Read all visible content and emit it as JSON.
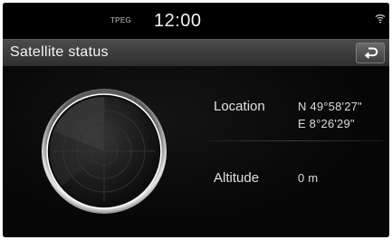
{
  "status_bar": {
    "source_label": "TPEG",
    "clock": "12:00",
    "signal_icon": "wifi-icon"
  },
  "header": {
    "title": "Satellite status",
    "back_icon": "back-arrow-icon"
  },
  "main": {
    "location_label": "Location",
    "latitude": "N 49°58'27\"",
    "longitude": "E 8°26'29\"",
    "altitude_label": "Altitude",
    "altitude_value": "0 m"
  },
  "colors": {
    "background": "#000000",
    "title_bar": "#3c3c3c",
    "text": "#e0e0e0"
  }
}
